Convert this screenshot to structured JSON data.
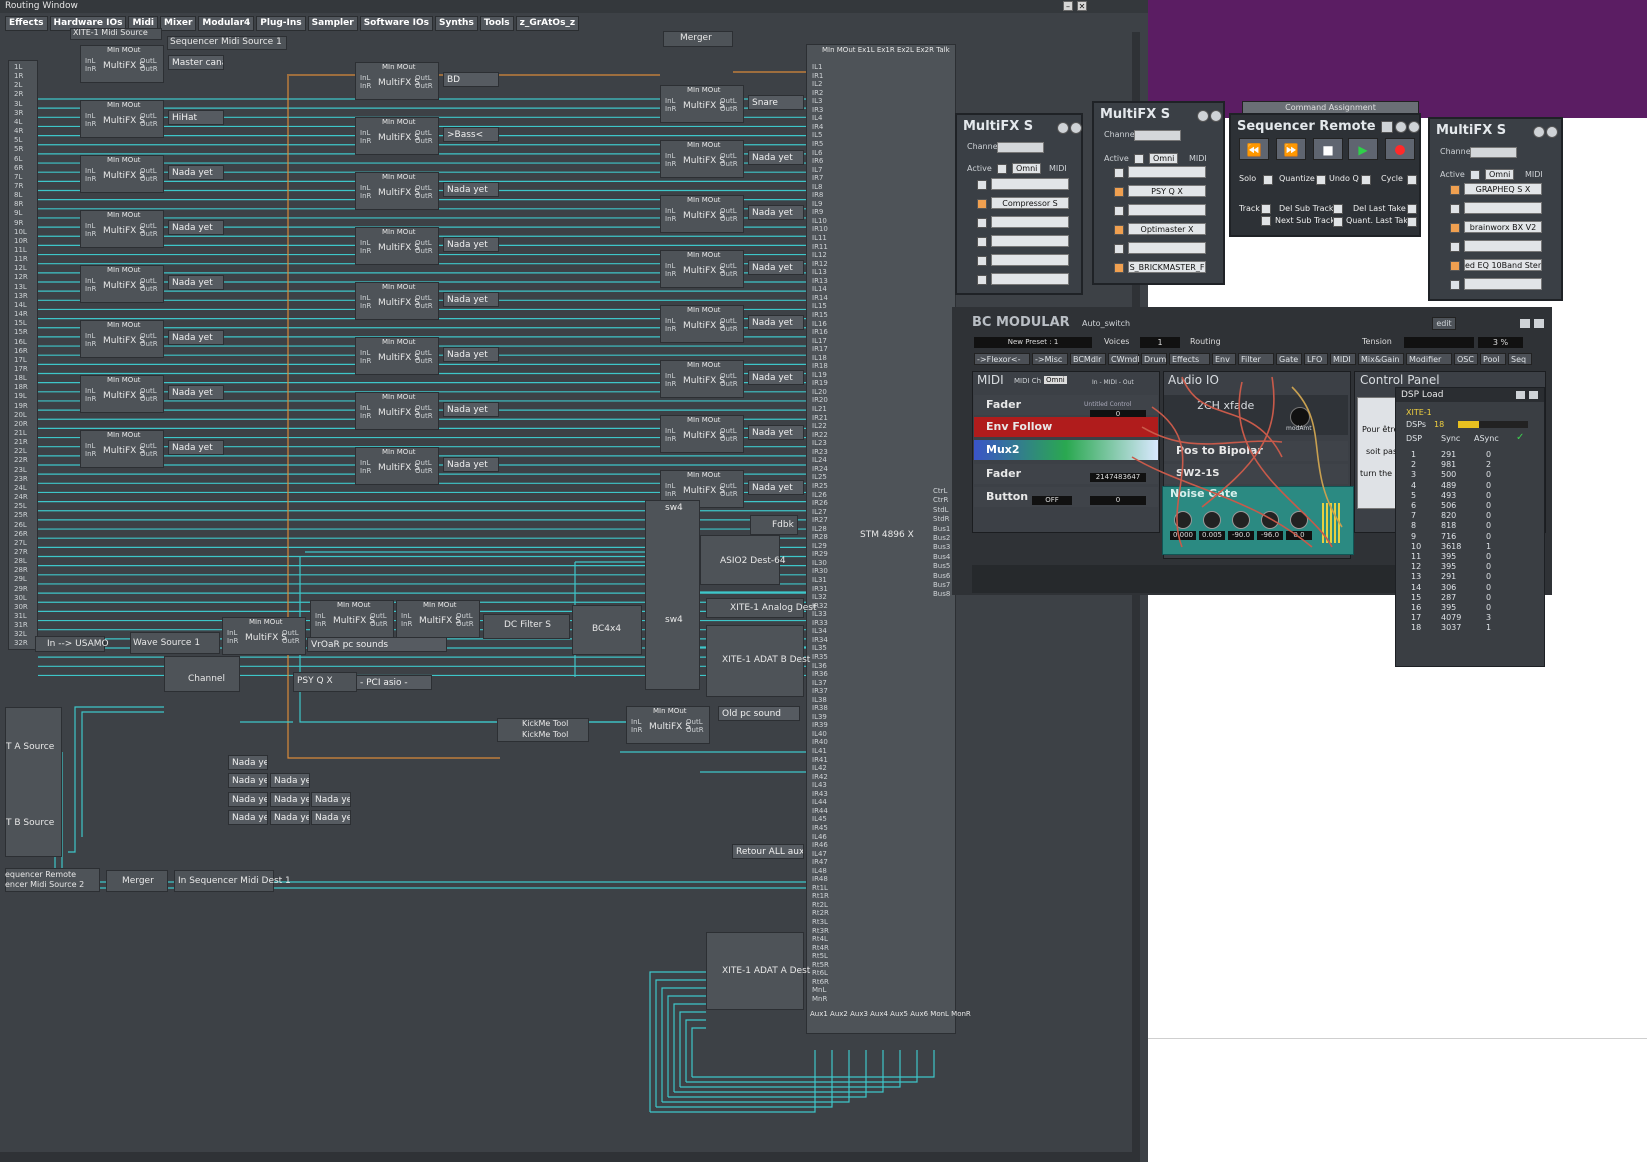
{
  "routing_window": {
    "title": "Routing Window",
    "menu": [
      "Effects",
      "Hardware IOs",
      "Midi",
      "Mixer",
      "Modular4",
      "Plug-Ins",
      "Sampler",
      "Software IOs",
      "Synths",
      "Tools",
      "z_GrAtOs_z"
    ],
    "sources": {
      "xite_midi": "XITE-1 Midi Source",
      "seq_midi_1": "Sequencer Midi Source 1",
      "merger_top": "Merger",
      "wave_source": "Wave Source 1",
      "usamo": "In --> USAMO",
      "a_source": "T A Source",
      "b_source": "T B Source",
      "seq_remote": "equencer Remote",
      "seq_midi_2": "encer Midi Source 2",
      "merger_bottom": "Merger",
      "seq_midi_dest": "In  Sequencer Midi Dest 1",
      "stm": "STM 4896 X",
      "asio": "ASIO2 Dest-64",
      "xite_analog": "XITE-1 Analog Dest",
      "xite_adat_b": "XITE-1 ADAT B Dest",
      "xite_adat_a": "XITE-1 ADAT A Dest",
      "bc4x4": "BC4x4",
      "dc_filter": "DC Filter S",
      "psy": "PSY Q X",
      "channel": "Channel",
      "kickme1": "KickMe Tool",
      "kickme2": "KickMe Tool",
      "fdbk": "Fdbk",
      "sw4a": "sw4",
      "sw4b": "sw4"
    },
    "multifx_label": "MultiFX S",
    "mini_head": "MIn MOut",
    "left_fx_labels": [
      "Master canal",
      "HiHat",
      "Nada yet",
      "Nada yet",
      "Nada yet",
      "Nada yet",
      "Nada yet",
      "Nada yet"
    ],
    "mid_fx_labels": [
      "BD",
      ">Bass<",
      "Nada yet",
      "Nada yet",
      "Nada yet",
      "Nada yet",
      "Nada yet",
      "Nada yet"
    ],
    "right_fx_labels": [
      "Snare",
      "Nada yet",
      "Nada yet",
      "Nada yet",
      "Nada yet",
      "Nada yet",
      "Nada yet",
      "Nada yet"
    ],
    "misc_labels": {
      "vroar": "VrOaR pc sounds",
      "pci": "- PCI asio -",
      "old_pc": "Old pc sound",
      "retour": "Retour ALL aux"
    },
    "nada_grid": [
      "Nada yet",
      "Nada yet",
      "Nada yet",
      "Nada yet",
      "Nada yet",
      "Nada yet",
      "Nada yet",
      "Nada yet",
      "Nada yet"
    ],
    "left_ports": [
      "1L",
      "1R",
      "2L",
      "2R",
      "3L",
      "3R",
      "4L",
      "4R",
      "5L",
      "5R",
      "6L",
      "6R",
      "7L",
      "7R",
      "8L",
      "8R",
      "9L",
      "9R",
      "10L",
      "10R",
      "11L",
      "11R",
      "12L",
      "12R",
      "13L",
      "13R",
      "14L",
      "14R",
      "15L",
      "15R",
      "16L",
      "16R",
      "17L",
      "17R",
      "18L",
      "18R",
      "19L",
      "19R",
      "20L",
      "20R",
      "21L",
      "21R",
      "22L",
      "22R",
      "23L",
      "23R",
      "24L",
      "24R",
      "25L",
      "25R",
      "26L",
      "26R",
      "27L",
      "27R",
      "28L",
      "28R",
      "29L",
      "29R",
      "30L",
      "30R",
      "31L",
      "31R",
      "32L",
      "32R"
    ],
    "stm_inputs": [
      "IL1",
      "IR1",
      "IL2",
      "IR2",
      "IL3",
      "IR3",
      "IL4",
      "IR4",
      "IL5",
      "IR5",
      "IL6",
      "IR6",
      "IL7",
      "IR7",
      "IL8",
      "IR8",
      "IL9",
      "IR9",
      "IL10",
      "IR10",
      "IL11",
      "IR11",
      "IL12",
      "IR12",
      "IL13",
      "IR13",
      "IL14",
      "IR14",
      "IL15",
      "IR15",
      "IL16",
      "IR16",
      "IL17",
      "IR17",
      "IL18",
      "IR18",
      "IL19",
      "IR19",
      "IL20",
      "IR20",
      "IL21",
      "IR21",
      "IL22",
      "IR22",
      "IL23",
      "IR23",
      "IL24",
      "IR24",
      "IL25",
      "IR25",
      "IL26",
      "IR26",
      "IL27",
      "IR27",
      "IL28",
      "IR28",
      "IL29",
      "IR29",
      "IL30",
      "IR30",
      "IL31",
      "IR31",
      "IL32",
      "IR32",
      "IL33",
      "IR33",
      "IL34",
      "IR34",
      "IL35",
      "IR35",
      "IL36",
      "IR36",
      "IL37",
      "IR37",
      "IL38",
      "IR38",
      "IL39",
      "IR39",
      "IL40",
      "IR40",
      "IL41",
      "IR41",
      "IL42",
      "IR42",
      "IL43",
      "IR43",
      "IL44",
      "IR44",
      "IL45",
      "IR45",
      "IL46",
      "IR46",
      "IL47",
      "IR47",
      "IL48",
      "IR48",
      "Rt1L",
      "Rt1R",
      "Rt2L",
      "Rt2R",
      "Rt3L",
      "Rt3R",
      "Rt4L",
      "Rt4R",
      "Rt5L",
      "Rt5R",
      "Rt6L",
      "Rt6R",
      "MnL",
      "MnR"
    ],
    "stm_top": "MIn MOut Ex1L Ex1R Ex2L Ex2R Talk",
    "stm_out": [
      "CtrL",
      "CtrR",
      "StdL",
      "StdR",
      "Bus1",
      "Bus2",
      "Bus3",
      "Bus4",
      "Bus5",
      "Bus6",
      "Bus7",
      "Bus8"
    ],
    "stm_bottom": "Aux1 Aux2 Aux3 Aux4 Aux5 Aux6 MonL MonR"
  },
  "multifx_windows": [
    {
      "title": "MultiFX S",
      "channel": "Channel",
      "active": "Active",
      "omni": "Omni",
      "midi": "MIDI",
      "slots": [
        "",
        "Compressor S",
        "",
        "",
        "",
        ""
      ]
    },
    {
      "title": "MultiFX S",
      "channel": "Channel",
      "active": "Active",
      "omni": "Omni",
      "midi": "MIDI",
      "slots": [
        "",
        "PSY Q X",
        "",
        "Optimaster X",
        "",
        "S_BRICKMASTER_F"
      ]
    },
    {
      "title": "MultiFX S",
      "channel": "Channel",
      "active": "Active",
      "omni": "Omni",
      "midi": "MIDI",
      "slots": [
        "GRAPHEQ S X",
        "",
        "brainworx BX V2",
        "",
        "ed EQ 10Band Stere",
        ""
      ]
    }
  ],
  "command_assignment": "Command Assignment",
  "sequencer_remote": {
    "title": "Sequencer Remote",
    "solo": "Solo",
    "quantize": "Quantize",
    "undo": "Undo Q",
    "cycle": "Cycle",
    "track": "Track",
    "del_sub": "Del Sub Track",
    "del_last": "Del Last Take",
    "next_sub": "Next Sub Track",
    "quant_last": "Quant. Last Take"
  },
  "bc_modular": {
    "title": "BC MODULAR",
    "preset_name": "Auto_switch",
    "preset": "New Preset : 1",
    "voices_lbl": "Voices",
    "voices": "1",
    "routing": "Routing",
    "tension": "Tension",
    "tension_val": "3 %",
    "edit": "edit",
    "tabs": [
      "->Flexor<-",
      "->Misc",
      "BCMdlr",
      "CWmdl",
      "Drum",
      "Effects",
      "Env",
      "Filter",
      "Gate",
      "LFO",
      "MIDI",
      "Mix&Gain",
      "Modifier",
      "OSC",
      "Pool",
      "Seq"
    ],
    "midi_panel": "MIDI",
    "midi_ch": "MIDI Ch",
    "omni": "Omni",
    "midi_inout": "In - MIDI - Out",
    "fader1": "Fader",
    "fader1_val": "0",
    "untitled": "Untitled Control",
    "env": "Env Follow",
    "mux": "Mux2",
    "fader2": "Fader",
    "fader2_val": "2147483647",
    "button": "Button",
    "button_val": "OFF",
    "button_num": "0",
    "audio_io": "Audio IO",
    "xfade": "2CH xfade",
    "modamt": "modAmt",
    "pos_bipolar": "Pos to Bipolar",
    "sw": "SW2-1S",
    "noise_gate": "Noise Gate",
    "gate_vals": [
      "0.000",
      "0.005",
      "-90.0",
      "-96.0",
      "0.0"
    ],
    "control_panel": "Control Panel",
    "cp_text": [
      "Pour être",
      "soit pas",
      "turn the"
    ]
  },
  "dsp_load": {
    "title": "DSP Load",
    "device": "XITE-1",
    "dsps_lbl": "DSPs",
    "dsps": "18",
    "cols": [
      "DSP",
      "Sync",
      "ASync"
    ],
    "rows": [
      [
        "1",
        "291",
        "0"
      ],
      [
        "2",
        "981",
        "2"
      ],
      [
        "3",
        "500",
        "0"
      ],
      [
        "4",
        "489",
        "0"
      ],
      [
        "5",
        "493",
        "0"
      ],
      [
        "6",
        "506",
        "0"
      ],
      [
        "7",
        "820",
        "0"
      ],
      [
        "8",
        "818",
        "0"
      ],
      [
        "9",
        "716",
        "0"
      ],
      [
        "10",
        "3618",
        "1"
      ],
      [
        "11",
        "395",
        "0"
      ],
      [
        "12",
        "395",
        "0"
      ],
      [
        "13",
        "291",
        "0"
      ],
      [
        "14",
        "306",
        "0"
      ],
      [
        "15",
        "287",
        "0"
      ],
      [
        "16",
        "395",
        "0"
      ],
      [
        "17",
        "4079",
        "3"
      ],
      [
        "18",
        "3037",
        "1"
      ]
    ]
  },
  "colors": {
    "cable": "#3ec6c9",
    "midi_cable": "#d98a3a",
    "purple": "#5b1d63",
    "routing_bg": "#3d4146"
  }
}
